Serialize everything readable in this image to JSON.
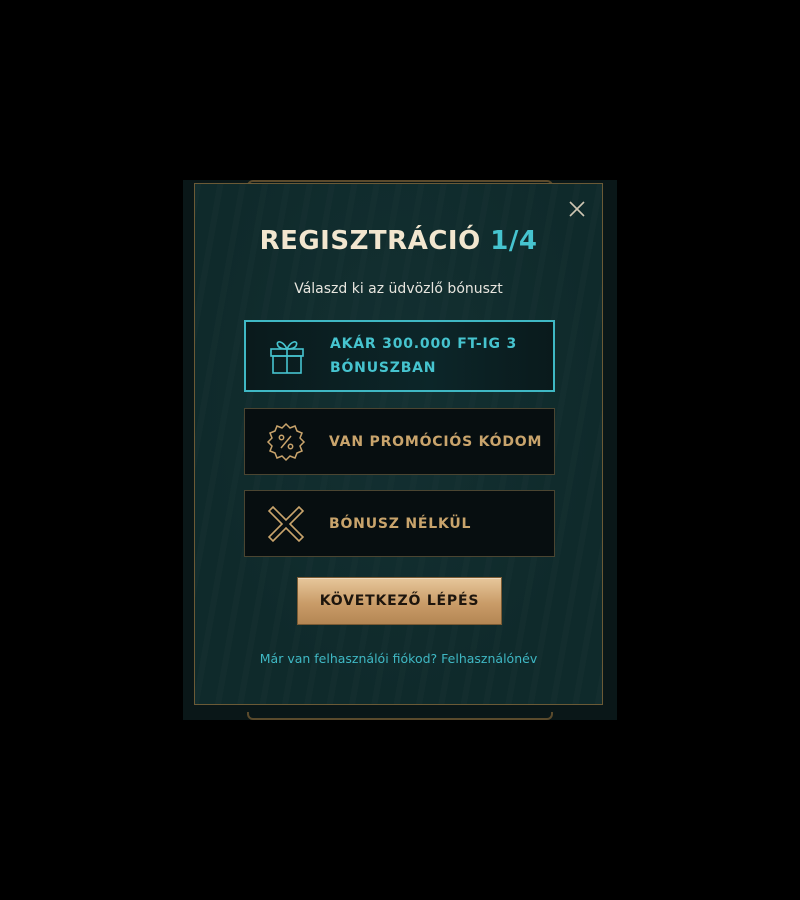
{
  "modal": {
    "title_main": "REGISZTRÁCIÓ",
    "title_step": "1/4",
    "subtitle": "Válaszd ki az üdvözlő bónuszt",
    "close_icon": "close-icon"
  },
  "options": [
    {
      "icon": "gift-icon",
      "line1": "AKÁR 300.000 FT-IG 3",
      "line2": "BÓNUSZBAN",
      "selected": true
    },
    {
      "icon": "percent-badge-icon",
      "line1": "VAN PROMÓCIÓS KÓDOM",
      "selected": false
    },
    {
      "icon": "cross-icon",
      "line1": "BÓNUSZ NÉLKÜL",
      "selected": false
    }
  ],
  "next_button": {
    "label": "KÖVETKEZŐ LÉPÉS"
  },
  "login": {
    "question": "Már van felhasználói fiókod?",
    "link": "Felhasználónév"
  },
  "colors": {
    "accent_teal": "#46c4cf",
    "accent_gold": "#c9a46c",
    "modal_bg": "#0f2a2b",
    "button_gold": "#d3aa77"
  }
}
